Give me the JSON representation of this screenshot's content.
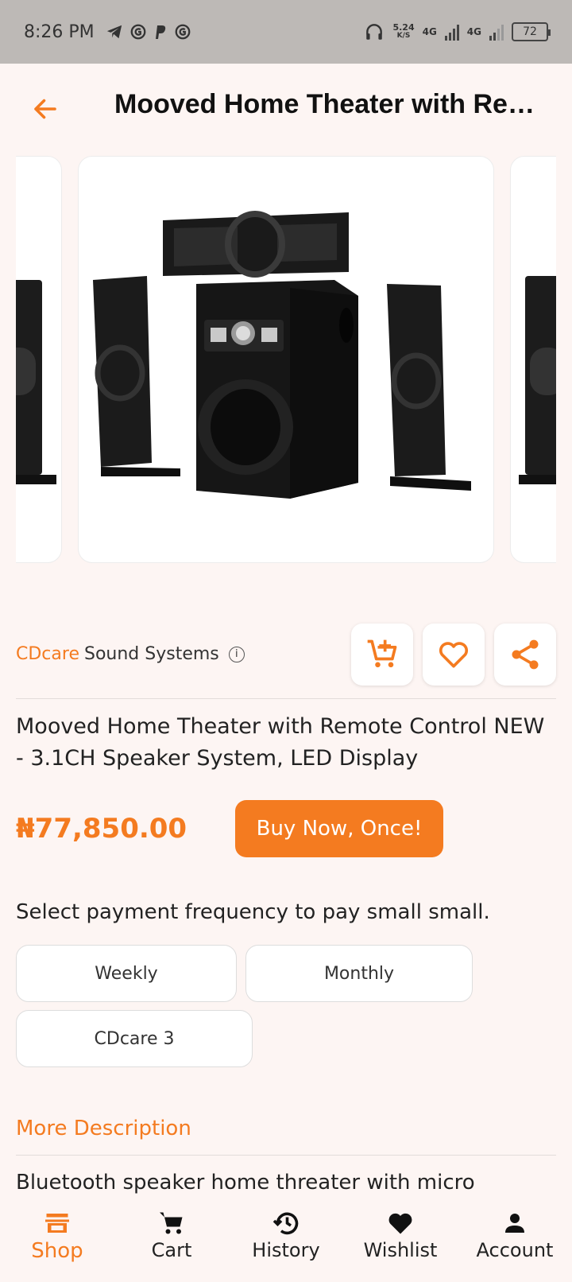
{
  "status_bar": {
    "time": "8:26 PM",
    "speed_value": "5.24",
    "speed_unit": "K/S",
    "network_1": "4G",
    "network_2": "4G",
    "battery": "72"
  },
  "header": {
    "title": "Mooved Home Theater with Remote Control NEW - 3.1CH Speaker System, LED Display"
  },
  "product": {
    "vendor_brand": "CDcare",
    "vendor_name": "Sound Systems",
    "description": "Mooved Home Theater with Remote Control NEW - 3.1CH Speaker System, LED Display",
    "price": "₦77,850.00",
    "buy_label": "Buy Now, Once!"
  },
  "payment": {
    "label": "Select payment frequency to pay small small.",
    "options": [
      "Weekly",
      "Monthly",
      "CDcare 3"
    ]
  },
  "more_description": {
    "heading": "More Description",
    "text": "Bluetooth speaker home threater with micro"
  },
  "bottom_nav": {
    "items": [
      {
        "label": "Shop",
        "icon": "shop-icon",
        "active": true
      },
      {
        "label": "Cart",
        "icon": "cart-icon"
      },
      {
        "label": "History",
        "icon": "history-icon"
      },
      {
        "label": "Wishlist",
        "icon": "heart-icon"
      },
      {
        "label": "Account",
        "icon": "person-icon"
      }
    ]
  },
  "colors": {
    "accent": "#f47b20",
    "background": "#fdf5f3",
    "status_bar": "#bdb9b6"
  }
}
